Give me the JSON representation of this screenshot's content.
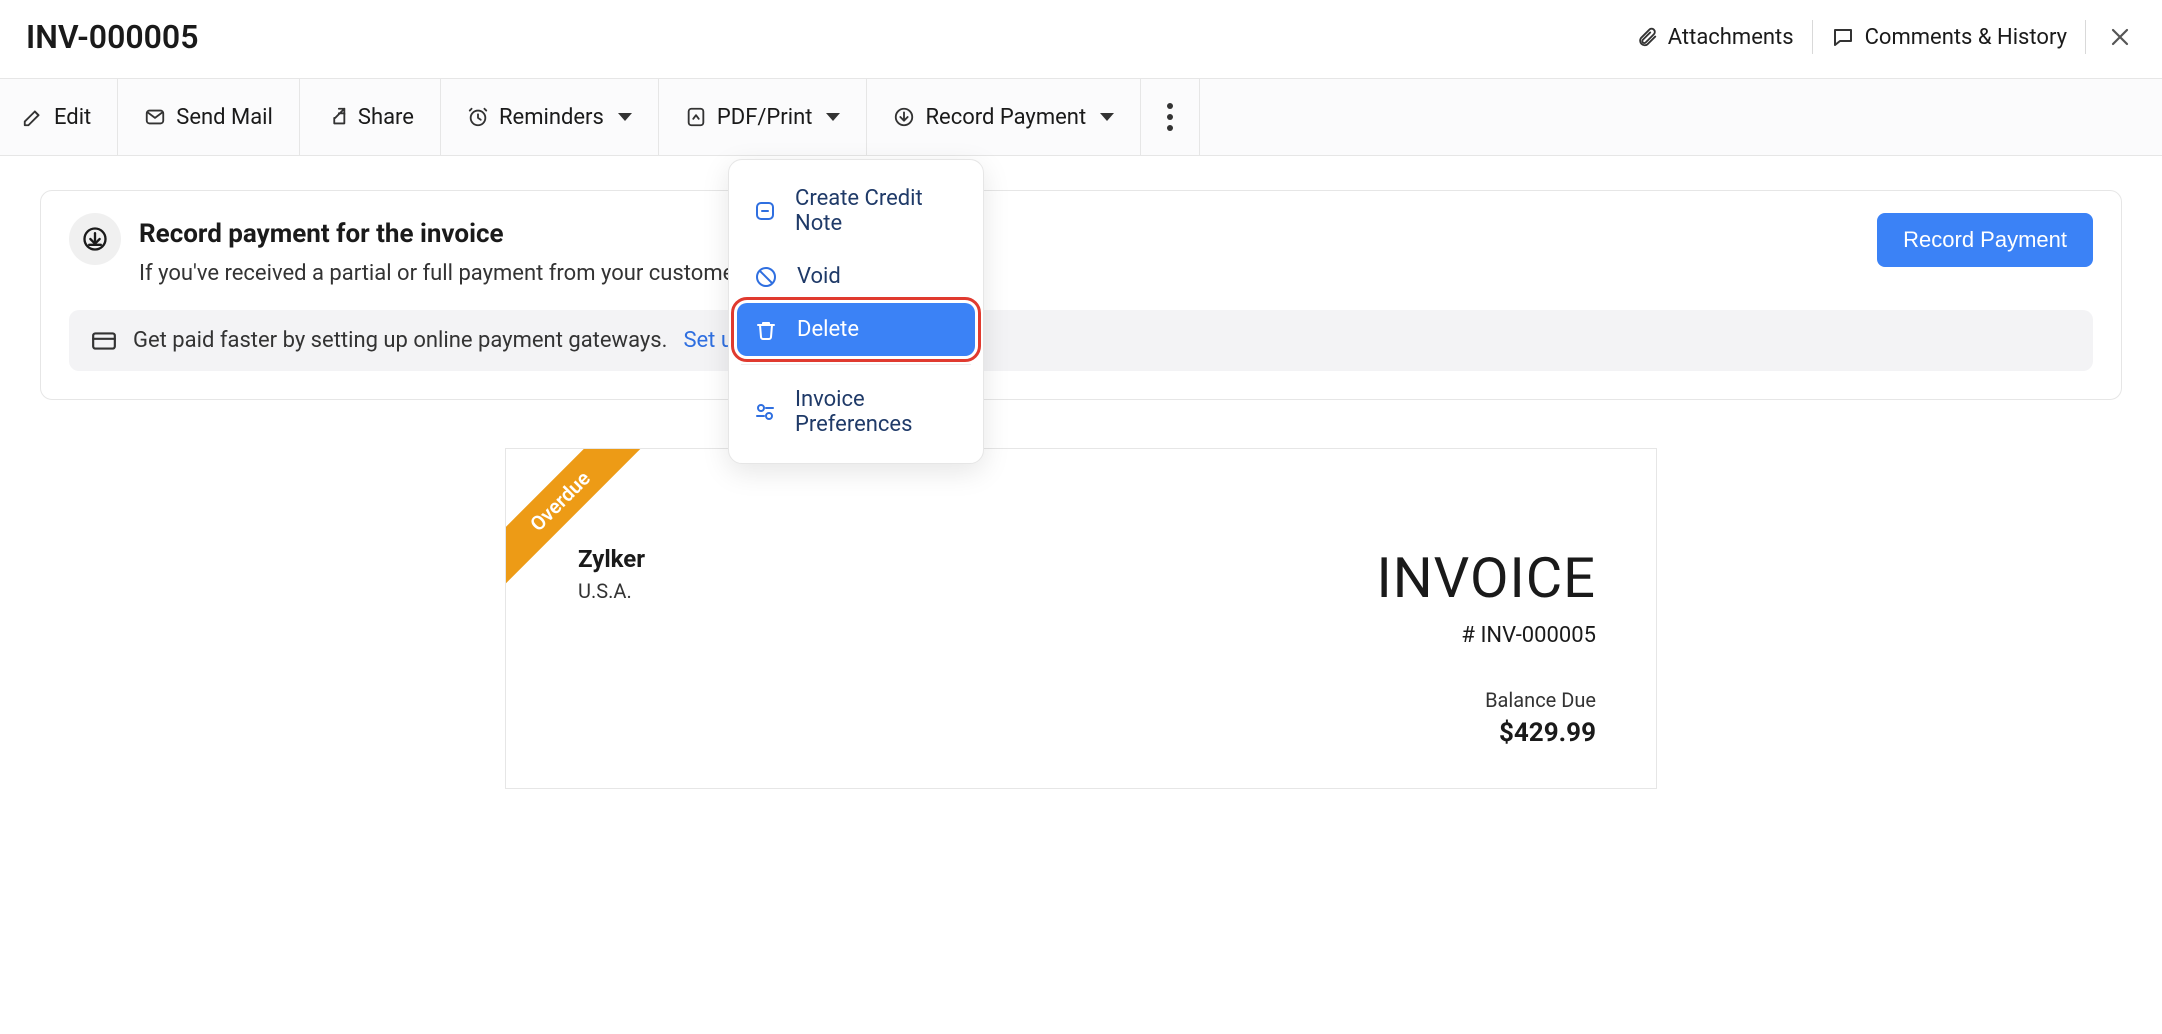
{
  "header": {
    "title": "INV-000005",
    "attachments_label": "Attachments",
    "comments_label": "Comments & History"
  },
  "toolbar": {
    "edit": "Edit",
    "send_mail": "Send Mail",
    "share": "Share",
    "reminders": "Reminders",
    "pdf_print": "PDF/Print",
    "record_payment": "Record Payment"
  },
  "callout": {
    "title": "Record payment for the invoice",
    "description": "If you've received a partial or full payment from your customer towards this",
    "button": "Record Payment"
  },
  "info_strip": {
    "text": "Get paid faster by setting up online payment gateways.",
    "link": "Set up Now",
    "chevron": "›"
  },
  "invoice": {
    "ribbon": "Overdue",
    "company_name": "Zylker",
    "company_location": "U.S.A.",
    "heading": "INVOICE",
    "number_prefix": "# ",
    "number": "INV-000005",
    "balance_label": "Balance Due",
    "balance_value": "$429.99"
  },
  "menu": {
    "create_credit_note": "Create Credit Note",
    "void": "Void",
    "delete": "Delete",
    "invoice_preferences": "Invoice Preferences"
  }
}
